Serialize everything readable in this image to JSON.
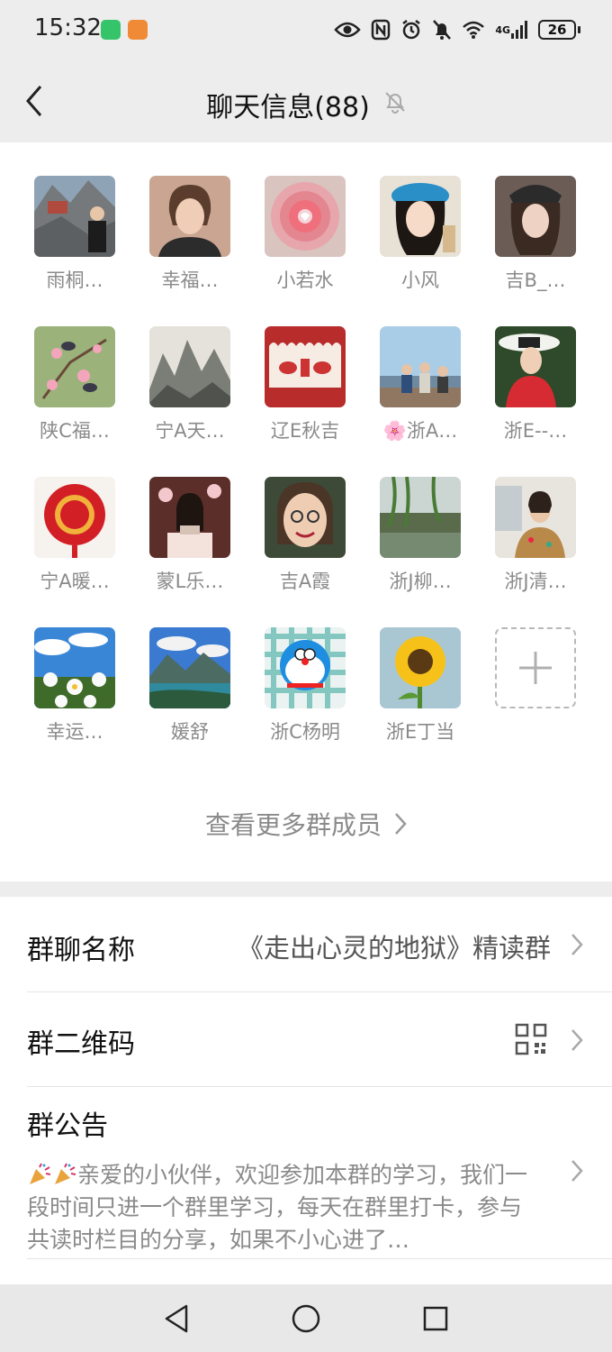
{
  "status_bar": {
    "time": "15:32",
    "network": "4G",
    "battery": "26"
  },
  "header": {
    "title": "聊天信息(88)",
    "back_icon": "chevron-left-icon",
    "mute_icon": "bell-off-icon"
  },
  "members": [
    {
      "name": "雨桐…"
    },
    {
      "name": "幸福…"
    },
    {
      "name": "小若水"
    },
    {
      "name": "小风"
    },
    {
      "name": "吉B_…"
    },
    {
      "name": "陕C福…"
    },
    {
      "name": "宁A天…"
    },
    {
      "name": "辽E秋吉"
    },
    {
      "name": "🌸浙A…"
    },
    {
      "name": "浙E--…"
    },
    {
      "name": "宁A暖…"
    },
    {
      "name": "蒙L乐…"
    },
    {
      "name": "吉A霞"
    },
    {
      "name": "浙J柳…"
    },
    {
      "name": "浙J清…"
    },
    {
      "name": "幸运…"
    },
    {
      "name": "媛舒"
    },
    {
      "name": "浙C杨明"
    },
    {
      "name": "浙E丁当"
    }
  ],
  "add_member_icon": "plus-icon",
  "view_more": "查看更多群成员",
  "settings": {
    "group_name_label": "群聊名称",
    "group_name_value": "《走出心灵的地狱》精读群",
    "qr_label": "群二维码",
    "qr_icon": "qr-code-icon",
    "notice_label": "群公告",
    "notice_text": "亲爱的小伙伴，欢迎参加本群的学习，我们一段时间只进一个群里学习，每天在群里打卡，参与共读时栏目的分享，如果不小心进了…"
  },
  "nav": {
    "back_icon": "triangle-back-icon",
    "home_icon": "circle-home-icon",
    "recent_icon": "square-recents-icon"
  }
}
